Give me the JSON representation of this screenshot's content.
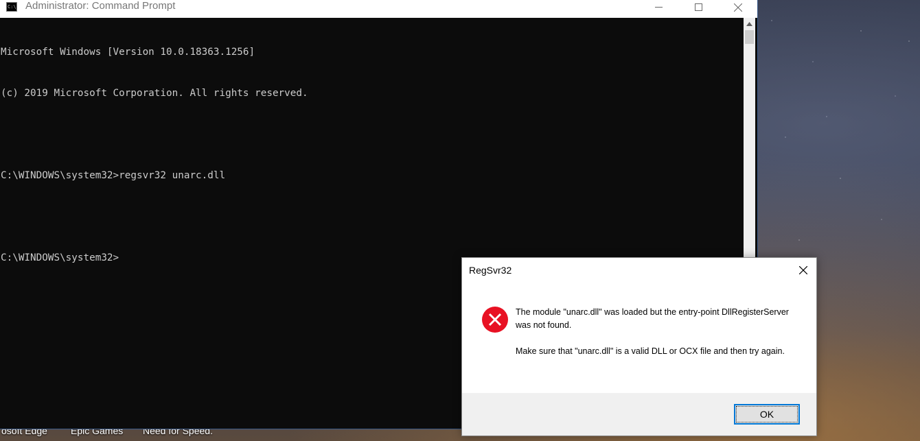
{
  "desktop": {
    "icons": [
      {
        "label": "osoft Edge"
      },
      {
        "label": "Epic Games"
      },
      {
        "label": "Need for Speed."
      }
    ]
  },
  "cmd": {
    "title": "Administrator: Command Prompt",
    "icon_text": "C:\\_",
    "console_lines": [
      "Microsoft Windows [Version 10.0.18363.1256]",
      "(c) 2019 Microsoft Corporation. All rights reserved.",
      "",
      "C:\\WINDOWS\\system32>regsvr32 unarc.dll",
      "",
      "C:\\WINDOWS\\system32>"
    ]
  },
  "dialog": {
    "title": "RegSvr32",
    "message_1": "The module \"unarc.dll\" was loaded but the entry-point DllRegisterServer was not found.",
    "message_2": "Make sure that \"unarc.dll\" is a valid DLL or OCX file and then try again.",
    "ok_label": "OK",
    "icon": "error-icon",
    "icon_color": "#e81123"
  }
}
